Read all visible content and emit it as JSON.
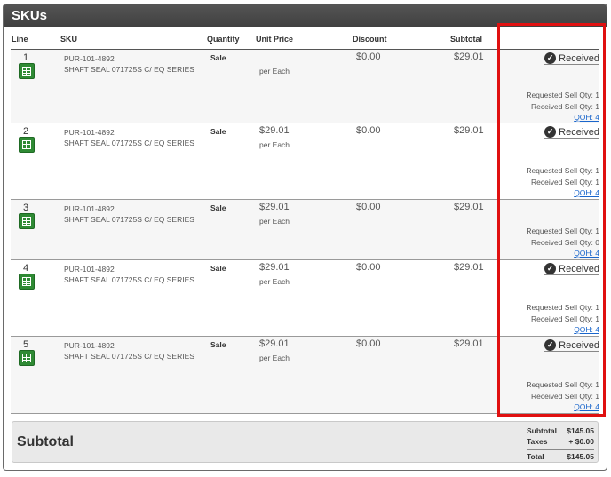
{
  "panel": {
    "title": "SKUs"
  },
  "columns": {
    "line": "Line",
    "sku": "SKU",
    "quantity": "Quantity",
    "unit_price": "Unit Price",
    "discount": "Discount",
    "subtotal": "Subtotal"
  },
  "rows": [
    {
      "line": "1",
      "sku_code": "PUR-101-4892",
      "sku_desc": "SHAFT SEAL 071725S C/ EQ SERIES",
      "quantity": "Sale",
      "unit_price": "",
      "per": "per Each",
      "discount": "$0.00",
      "subtotal": "$29.01",
      "status": "Received",
      "requested": "Requested Sell Qty: 1",
      "received": "Received Sell Qty: 1",
      "qoh": "QOH: 4"
    },
    {
      "line": "2",
      "sku_code": "PUR-101-4892",
      "sku_desc": "SHAFT SEAL 071725S C/ EQ SERIES",
      "quantity": "Sale",
      "unit_price": "$29.01",
      "per": "per Each",
      "discount": "$0.00",
      "subtotal": "$29.01",
      "status": "Received",
      "requested": "Requested Sell Qty: 1",
      "received": "Received Sell Qty: 1",
      "qoh": "QOH: 4"
    },
    {
      "line": "3",
      "sku_code": "PUR-101-4892",
      "sku_desc": "SHAFT SEAL 071725S C/ EQ SERIES",
      "quantity": "Sale",
      "unit_price": "$29.01",
      "per": "per Each",
      "discount": "$0.00",
      "subtotal": "$29.01",
      "status": "",
      "requested": "Requested Sell Qty: 1",
      "received": "Received Sell Qty: 0",
      "qoh": "QOH: 4"
    },
    {
      "line": "4",
      "sku_code": "PUR-101-4892",
      "sku_desc": "SHAFT SEAL 071725S C/ EQ SERIES",
      "quantity": "Sale",
      "unit_price": "$29.01",
      "per": "per Each",
      "discount": "$0.00",
      "subtotal": "$29.01",
      "status": "Received",
      "requested": "Requested Sell Qty: 1",
      "received": "Received Sell Qty: 1",
      "qoh": "QOH: 4"
    },
    {
      "line": "5",
      "sku_code": "PUR-101-4892",
      "sku_desc": "SHAFT SEAL 071725S C/ EQ SERIES",
      "quantity": "Sale",
      "unit_price": "$29.01",
      "per": "per Each",
      "discount": "$0.00",
      "subtotal": "$29.01",
      "status": "Received",
      "requested": "Requested Sell Qty: 1",
      "received": "Received Sell Qty: 1",
      "qoh": "QOH: 4"
    }
  ],
  "summary": {
    "title": "Subtotal",
    "subtotal_label": "Subtotal",
    "subtotal_value": "$145.05",
    "taxes_label": "Taxes",
    "taxes_value": "+ $0.00",
    "total_label": "Total",
    "total_value": "$145.05"
  },
  "colors": {
    "highlight": "#e01010",
    "sheet_icon": "#2f8a34",
    "link": "#1a66cc"
  }
}
